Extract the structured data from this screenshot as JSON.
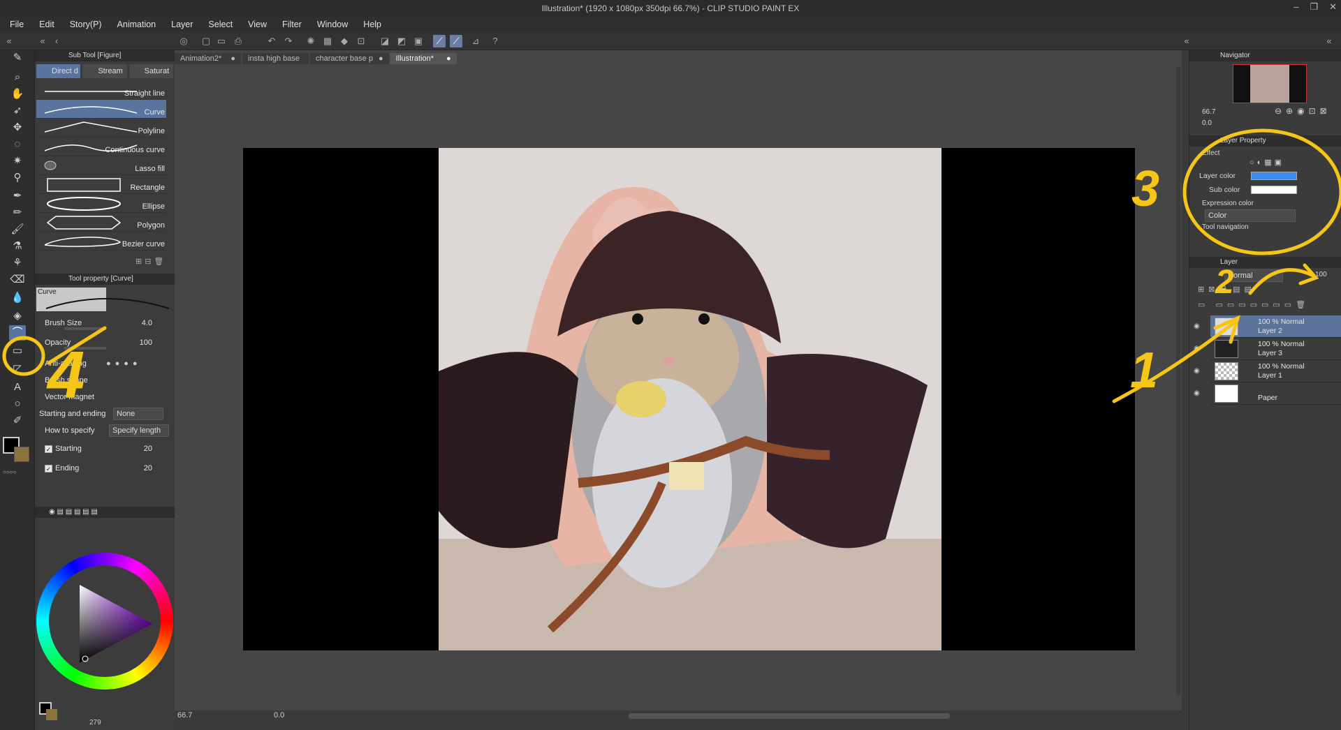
{
  "window": {
    "title": "Illustration* (1920 x 1080px 350dpi 66.7%)  - CLIP STUDIO PAINT EX"
  },
  "menu": [
    "File",
    "Edit",
    "Story(P)",
    "Animation",
    "Layer",
    "Select",
    "View",
    "Filter",
    "Window",
    "Help"
  ],
  "doc_tabs": [
    {
      "label": "Animation2*",
      "selected": false
    },
    {
      "label": "insta high base",
      "selected": false
    },
    {
      "label": "character base p",
      "selected": false
    },
    {
      "label": "Illustration*",
      "selected": true
    }
  ],
  "subtool": {
    "header": "Sub Tool [Figure]",
    "tabs": [
      "Direct d",
      "Stream",
      "Saturat"
    ],
    "items": [
      "Straight line",
      "Curve",
      "Polyline",
      "Continuous curve",
      "Lasso fill",
      "Rectangle",
      "Ellipse",
      "Polygon",
      "Bezier curve"
    ],
    "selected": "Curve"
  },
  "toolprop": {
    "header": "Tool property [Curve]",
    "preview_label": "Curve",
    "brush_size_label": "Brush Size",
    "brush_size": "4.0",
    "opacity_label": "Opacity",
    "opacity": "100",
    "antialias_label": "Anti-aliasing",
    "brush_shape_label": "Brush shape",
    "vector_magnet_label": "Vector magnet",
    "start_end_label": "Starting and ending",
    "start_end_value": "None",
    "how_label": "How to specify",
    "how_value": "Specify length",
    "starting_label": "Starting",
    "starting_value": "20",
    "ending_label": "Ending",
    "ending_value": "20"
  },
  "status": {
    "zoom": "66.7",
    "angle": "0.0",
    "mem": "279",
    "x": "0",
    "y": "0"
  },
  "navigator": {
    "header": "Navigator",
    "zoom": "66.7",
    "angle": "0.0"
  },
  "layer_property": {
    "header": "Layer Property",
    "effect_label": "Effect",
    "layer_color_label": "Layer color",
    "layer_color": "#3c8cf0",
    "sub_color_label": "Sub color",
    "sub_color": "#ffffff",
    "expression_label": "Expression color",
    "expression_value": "Color",
    "tool_nav_label": "Tool navigation"
  },
  "layers": {
    "header": "Layer",
    "blend": "Normal",
    "opacity": "100",
    "items": [
      {
        "pct": "100 % Normal",
        "name": "Layer 2",
        "selected": true
      },
      {
        "pct": "100 % Normal",
        "name": "Layer 3",
        "selected": false
      },
      {
        "pct": "100 % Normal",
        "name": "Layer 1",
        "selected": false
      },
      {
        "pct": "",
        "name": "Paper",
        "selected": false
      }
    ]
  },
  "annotations": {
    "n1": "1",
    "n2": "2",
    "n3": "3",
    "n4": "4",
    "color": "#f5c518"
  }
}
